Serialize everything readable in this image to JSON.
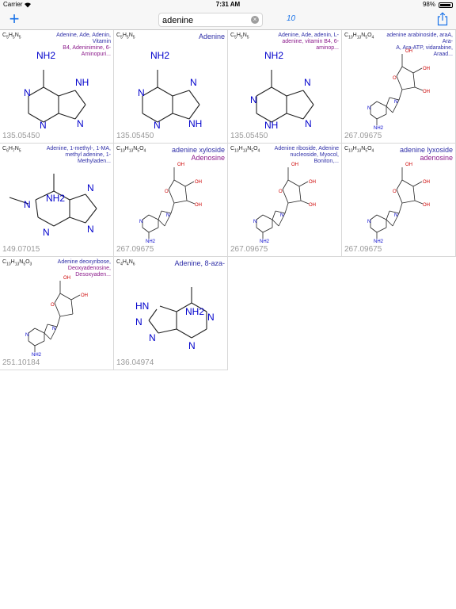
{
  "status": {
    "carrier": "Carrier",
    "time": "7:31 AM",
    "battery": "98%"
  },
  "toolbar": {
    "add_label": "+",
    "search_value": "adenine",
    "result_count": "10"
  },
  "cards": [
    {
      "formula": "C5H5N5",
      "names": [
        "Adenine, Ade, Adenin, Vitamin",
        "B4, Adeninimine, 6-Aminopuri..."
      ],
      "mass": "135.05450"
    },
    {
      "formula": "C5H5N5",
      "names": [
        "Adenine"
      ],
      "mass": "135.05450"
    },
    {
      "formula": "C5H5N5",
      "names": [
        "Adenine, Ade, adenin, L-",
        "adenine, vitamin B4, 6-aminop..."
      ],
      "mass": "135.05450"
    },
    {
      "formula": "C10H13N5O4",
      "names": [
        "adenine arabinoside, araA, Ara-",
        "A, Ara-ATP, vidarabine, Araad..."
      ],
      "mass": "267.09675"
    },
    {
      "formula": "C6H7N5",
      "names": [
        "Adenine, 1-methyl-, 1-MA,",
        "methyl adenine, 1-Methyladen..."
      ],
      "mass": "149.07015"
    },
    {
      "formula": "C10H13N5O4",
      "names": [
        "adenine xyloside",
        "Adenosine"
      ],
      "mass": "267.09675"
    },
    {
      "formula": "C10H13N5O4",
      "names": [
        "Adenine riboside, Adenine",
        "nucleoside, Myocol, Boniton,..."
      ],
      "mass": "267.09675"
    },
    {
      "formula": "C10H13N5O4",
      "names": [
        "adenine lyxoside",
        "adenosine"
      ],
      "mass": "267.09675"
    },
    {
      "formula": "C10H13N5O3",
      "names": [
        "Adenine deoxyribose,",
        "Deoxyadenosine, Desoxyaden..."
      ],
      "mass": "251.10184"
    },
    {
      "formula": "C4H4N6",
      "names": [
        "Adenine, 8-aza-"
      ],
      "mass": "136.04974"
    }
  ],
  "atoms": {
    "nh2": "NH2",
    "nh": "NH",
    "n": "N",
    "hn": "HN",
    "oh": "OH",
    "o": "O"
  },
  "colors": {
    "accent": "#1a73e8",
    "nitrogen": "#0000cc",
    "oxygen": "#cc0000"
  }
}
